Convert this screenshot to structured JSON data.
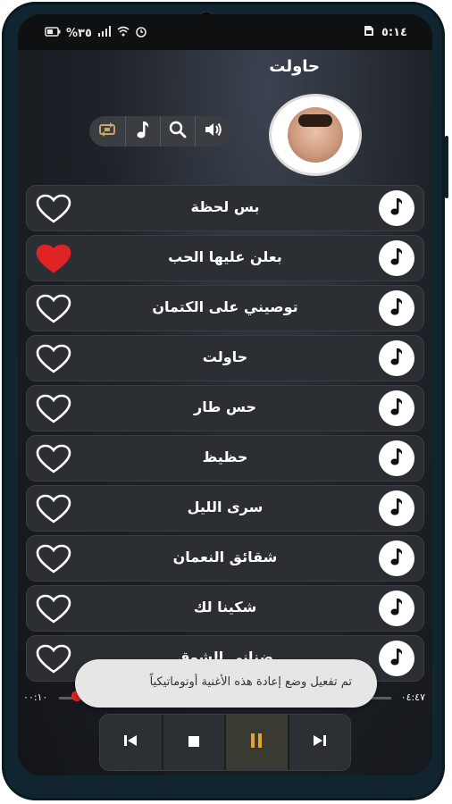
{
  "status_bar": {
    "battery": "%٣٥",
    "time": "٥:١٤",
    "icons": [
      "battery-icon",
      "signal-icon",
      "wifi-icon",
      "alarm-icon",
      "sim-icon"
    ]
  },
  "header": {
    "title": "حاولت"
  },
  "controls": [
    {
      "icon": "repeat-icon"
    },
    {
      "icon": "music-note-icon"
    },
    {
      "icon": "search-icon"
    },
    {
      "icon": "volume-icon"
    }
  ],
  "songs": [
    {
      "title": "بس لحظة",
      "favorite": false
    },
    {
      "title": "بعلن عليها الحب",
      "favorite": true
    },
    {
      "title": "توصيني على الكتمان",
      "favorite": false
    },
    {
      "title": "حاولت",
      "favorite": false
    },
    {
      "title": "حس طار",
      "favorite": false
    },
    {
      "title": "حظيظ",
      "favorite": false
    },
    {
      "title": "سرى الليل",
      "favorite": false
    },
    {
      "title": "شقائق النعمان",
      "favorite": false
    },
    {
      "title": "شكينا لك",
      "favorite": false
    },
    {
      "title": "ضناني الشوق",
      "favorite": false
    }
  ],
  "player": {
    "current_time": "٠٠:١٠",
    "total_time": "٠٤:٤٧",
    "progress": 0.04,
    "buttons": [
      "previous-icon",
      "stop-icon",
      "pause-icon",
      "next-icon"
    ]
  },
  "toast": {
    "message": "تم تفعيل وضع إعادة هذه الأغنية أوتوماتيكياً"
  },
  "colors": {
    "accent": "#e02424",
    "row_bg": "#2b2e33",
    "pause_active": "#e0a52a"
  }
}
